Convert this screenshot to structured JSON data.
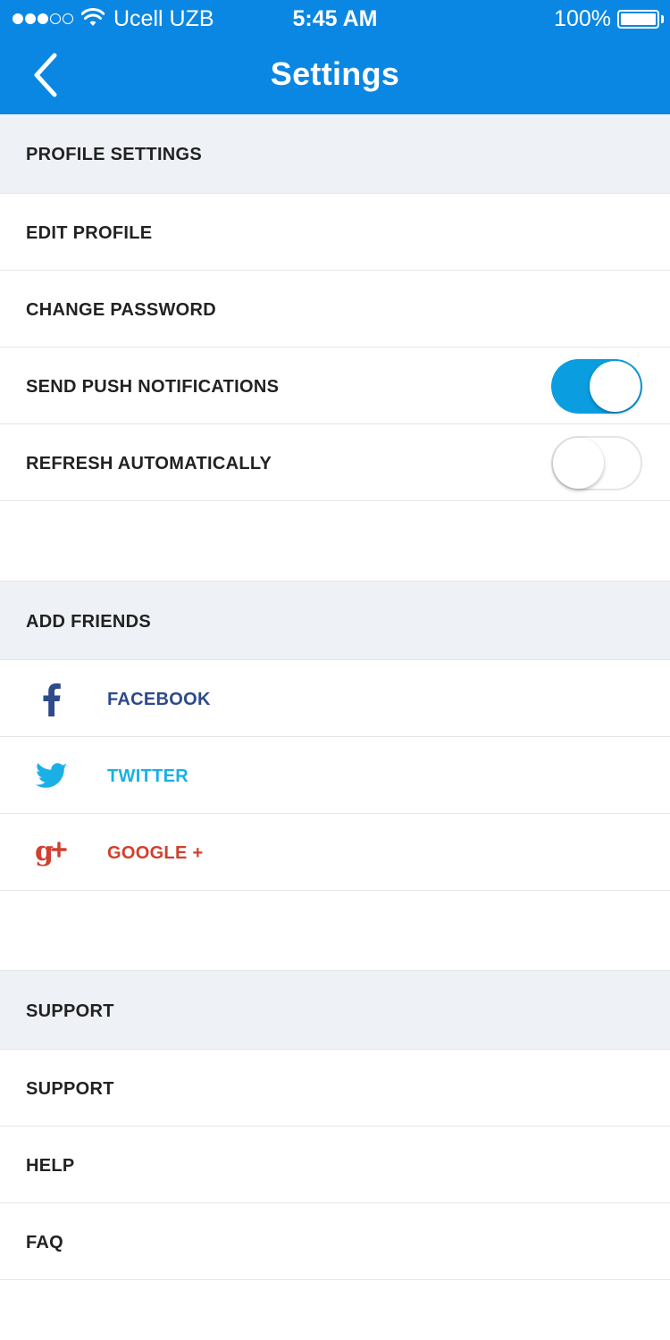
{
  "status_bar": {
    "signal_filled": 3,
    "signal_total": 5,
    "carrier": "Ucell UZB",
    "time": "5:45 AM",
    "battery": "100%",
    "battery_level": 1.0
  },
  "header": {
    "title": "Settings",
    "back_icon": "chevron-left-icon",
    "color": "#0a87e3"
  },
  "sections": {
    "profile": {
      "header": "PROFILE SETTINGS",
      "edit_profile": "EDIT PROFILE",
      "change_password": "CHANGE PASSWORD",
      "push_notifications": {
        "label": "SEND PUSH NOTIFICATIONS",
        "enabled": true
      },
      "refresh_automatically": {
        "label": "REFRESH AUTOMATICALLY",
        "enabled": false
      }
    },
    "add_friends": {
      "header": "ADD FRIENDS",
      "facebook": {
        "label": "FACEBOOK",
        "icon": "facebook-icon",
        "color": "#2d4a8b"
      },
      "twitter": {
        "label": "TWITTER",
        "icon": "twitter-icon",
        "color": "#1ab0e6"
      },
      "google": {
        "label": "GOOGLE +",
        "icon": "google-plus-icon",
        "color": "#d0402e"
      }
    },
    "support": {
      "header": "SUPPORT",
      "support": "SUPPORT",
      "help": "HELP",
      "faq": "FAQ"
    }
  },
  "colors": {
    "toggle_on": "#0a9de0",
    "section_bg": "#eef1f6"
  }
}
